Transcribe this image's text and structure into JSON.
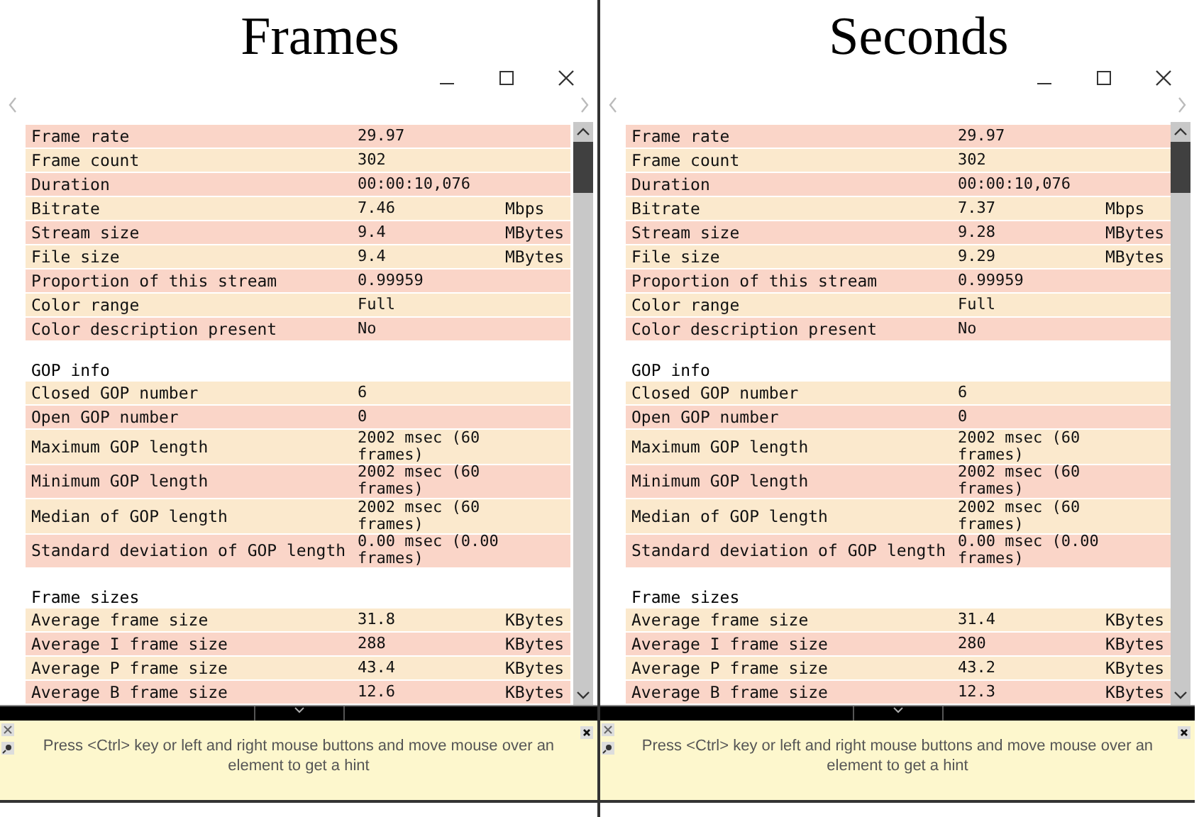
{
  "panels": [
    {
      "heading": "Frames",
      "hint": "Press <Ctrl> key or left and right mouse buttons and move mouse over an element to get a hint",
      "sections": [
        {
          "rows": [
            {
              "label": "Frame rate",
              "value": "29.97"
            },
            {
              "label": "Frame count",
              "value": "302"
            },
            {
              "label": "Duration",
              "value": "00:00:10,076"
            },
            {
              "label": "Bitrate",
              "value": "7.46",
              "unit": "Mbps"
            },
            {
              "label": "Stream size",
              "value": "9.4",
              "unit": "MBytes"
            },
            {
              "label": "File size",
              "value": "9.4",
              "unit": "MBytes"
            },
            {
              "label": "Proportion of this stream",
              "value": "0.99959"
            },
            {
              "label": "Color range",
              "value": "Full"
            },
            {
              "label": "Color description present",
              "value": "No"
            }
          ]
        },
        {
          "title": "GOP info",
          "rows": [
            {
              "label": "Closed GOP number",
              "value": "6"
            },
            {
              "label": "Open GOP number",
              "value": "0"
            },
            {
              "label": "Maximum GOP length",
              "value": "2002 msec (60 frames)"
            },
            {
              "label": "Minimum GOP length",
              "value": "2002 msec (60 frames)"
            },
            {
              "label": "Median of GOP length",
              "value": "2002 msec (60 frames)"
            },
            {
              "label": "Standard deviation of GOP length",
              "value": "0.00 msec (0.00 frames)"
            }
          ]
        },
        {
          "title": "Frame sizes",
          "rows": [
            {
              "label": "Average frame size",
              "value": "31.8",
              "unit": "KBytes"
            },
            {
              "label": "Average I frame size",
              "value": "288",
              "unit": "KBytes"
            },
            {
              "label": "Average P frame size",
              "value": "43.4",
              "unit": "KBytes"
            },
            {
              "label": "Average B frame size",
              "value": "12.6",
              "unit": "KBytes"
            }
          ]
        }
      ]
    },
    {
      "heading": "Seconds",
      "hint": "Press <Ctrl> key or left and right mouse buttons and move mouse over an element to get a hint",
      "sections": [
        {
          "rows": [
            {
              "label": "Frame rate",
              "value": "29.97"
            },
            {
              "label": "Frame count",
              "value": "302"
            },
            {
              "label": "Duration",
              "value": "00:00:10,076"
            },
            {
              "label": "Bitrate",
              "value": "7.37",
              "unit": "Mbps"
            },
            {
              "label": "Stream size",
              "value": "9.28",
              "unit": "MBytes"
            },
            {
              "label": "File size",
              "value": "9.29",
              "unit": "MBytes"
            },
            {
              "label": "Proportion of this stream",
              "value": "0.99959"
            },
            {
              "label": "Color range",
              "value": "Full"
            },
            {
              "label": "Color description present",
              "value": "No"
            }
          ]
        },
        {
          "title": "GOP info",
          "rows": [
            {
              "label": "Closed GOP number",
              "value": "6"
            },
            {
              "label": "Open GOP number",
              "value": "0"
            },
            {
              "label": "Maximum GOP length",
              "value": "2002 msec (60 frames)"
            },
            {
              "label": "Minimum GOP length",
              "value": "2002 msec (60 frames)"
            },
            {
              "label": "Median of GOP length",
              "value": "2002 msec (60 frames)"
            },
            {
              "label": "Standard deviation of GOP length",
              "value": "0.00 msec (0.00 frames)"
            }
          ]
        },
        {
          "title": "Frame sizes",
          "rows": [
            {
              "label": "Average frame size",
              "value": "31.4",
              "unit": "KBytes"
            },
            {
              "label": "Average I frame size",
              "value": "280",
              "unit": "KBytes"
            },
            {
              "label": "Average P frame size",
              "value": "43.2",
              "unit": "KBytes"
            },
            {
              "label": "Average B frame size",
              "value": "12.3",
              "unit": "KBytes"
            }
          ]
        }
      ]
    }
  ]
}
